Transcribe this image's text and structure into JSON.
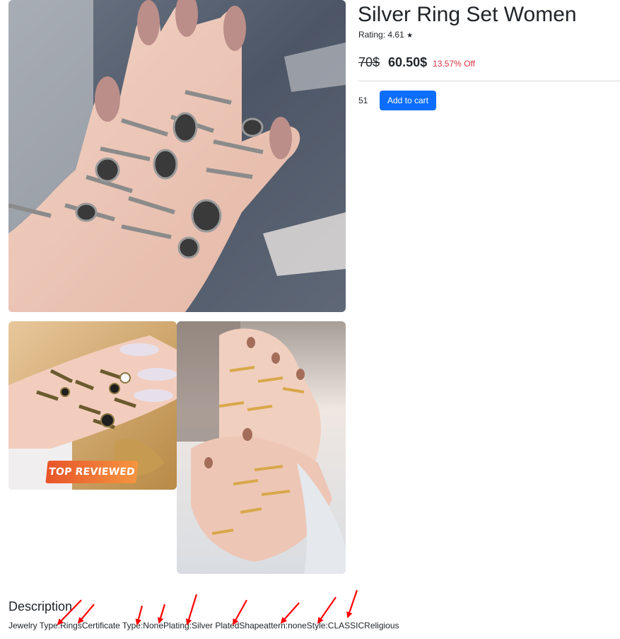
{
  "product": {
    "title": "Silver Ring Set Women",
    "rating_label": "Rating: 4.61",
    "rating_star": "★",
    "old_price": "70$",
    "new_price": "60.50$",
    "discount": "13.57% Off",
    "stock_count": "51",
    "add_to_cart_label": "Add to cart"
  },
  "gallery": {
    "badge_text": "TOP REVIEWED"
  },
  "description": {
    "heading": "Description",
    "text": "Jewelry Type:RingsCertificate Type:NonePlating:Silver PlatedShapeattern:noneStyle:CLASSICReligious"
  },
  "colors": {
    "accent": "#0d6efd",
    "discount": "#dc3545",
    "annotation_arrow": "#ff0000"
  }
}
